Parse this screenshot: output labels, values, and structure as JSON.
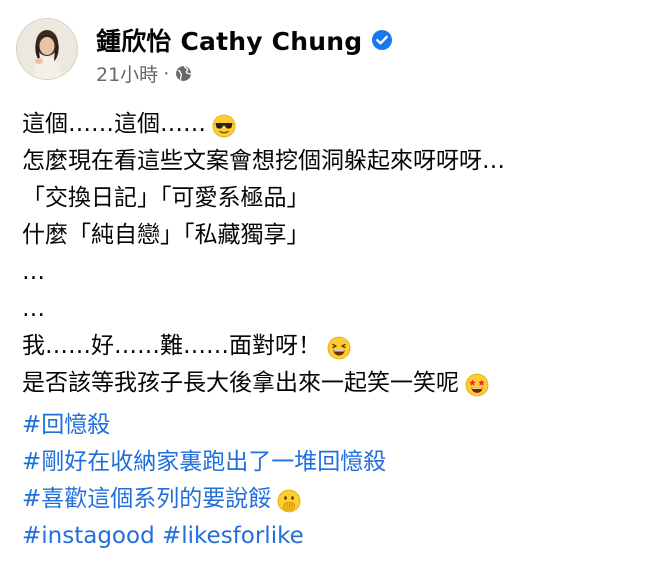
{
  "author": {
    "name": "鍾欣怡 Cathy Chung",
    "verified_icon": "verified-badge-icon",
    "timestamp": "21小時",
    "separator": "·",
    "audience_icon": "globe-icon"
  },
  "post": {
    "lines": [
      "這個……這個……",
      "怎麼現在看這些文案會想挖個洞躲起來呀呀呀…",
      "「交換日記」「可愛系極品」",
      "什麼「純自戀」「私藏獨享」",
      "…",
      "…",
      "我……好……難……面對呀！",
      "是否該等我孩子長大後拿出來一起笑一笑呢"
    ],
    "emojis": {
      "line1": "sunglasses-emoji",
      "line7": "grinning-squinting-emoji",
      "line8": "star-struck-emoji",
      "hashtag3": "face-with-hand-over-mouth-emoji"
    },
    "hashtags": [
      "#回憶殺",
      "#剛好在收納家裏跑出了一堆回憶殺",
      "#喜歡這個系列的要說餒",
      "#instagood",
      "#likesforlike"
    ]
  },
  "colors": {
    "text": "#050505",
    "secondary": "#65676b",
    "link": "#216fdb",
    "verified": "#1877f2"
  }
}
